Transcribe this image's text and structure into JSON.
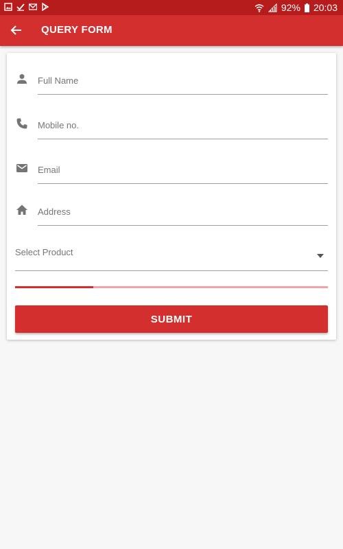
{
  "status_bar": {
    "battery": "92%",
    "time": "20:03",
    "left_icons": [
      "gallery-icon",
      "check-icon",
      "gmail-icon",
      "play-store-icon"
    ],
    "right_icons": [
      "wifi-icon",
      "signal-icon",
      "battery-icon"
    ]
  },
  "app_bar": {
    "title": "QUERY FORM",
    "back_icon": "arrow-back-icon"
  },
  "form": {
    "full_name": {
      "placeholder": "Full Name",
      "icon": "person-icon"
    },
    "mobile": {
      "placeholder": "Mobile no.",
      "icon": "phone-icon"
    },
    "email": {
      "placeholder": "Email",
      "icon": "email-icon"
    },
    "address": {
      "placeholder": "Address",
      "icon": "home-icon"
    },
    "product": {
      "label": "Select Product",
      "icon": "dropdown-arrow-icon"
    },
    "progress_fraction": 0.25,
    "submit_label": "SUBMIT"
  },
  "colors": {
    "primary": "#d32f2f",
    "primary_dark": "#b71c1c",
    "progress_track": "#f3a3a3",
    "background": "#f7f7f7"
  }
}
